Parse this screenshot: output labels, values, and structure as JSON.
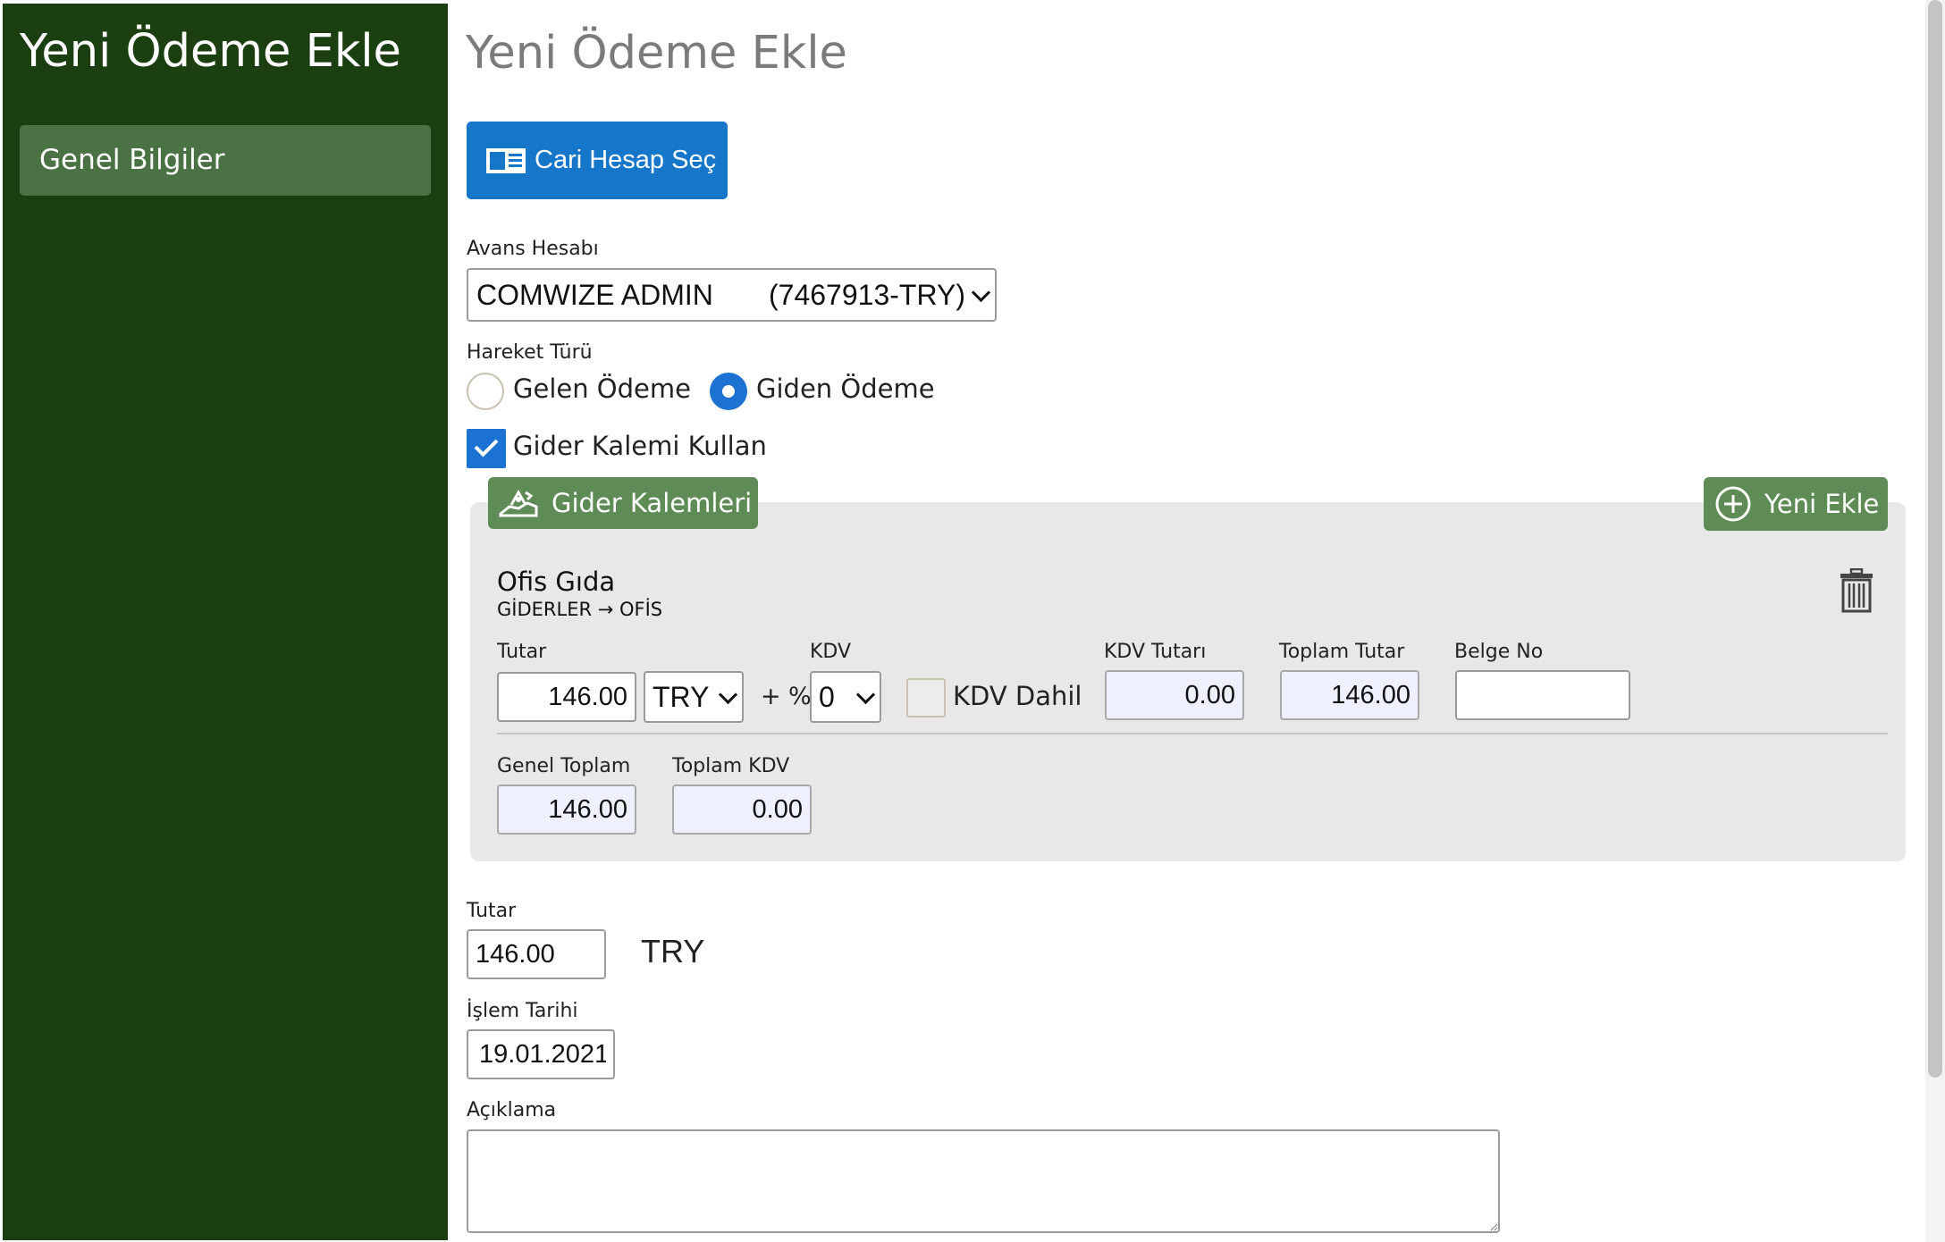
{
  "sidebar": {
    "title": "Yeni Ödeme Ekle",
    "items": [
      {
        "label": "Genel Bilgiler"
      }
    ]
  },
  "main": {
    "title": "Yeni Ödeme Ekle",
    "cari_button": "Cari Hesap Seç",
    "avans": {
      "label": "Avans Hesabı",
      "selected_name": "COMWIZE ADMIN",
      "selected_code": "(7467913-TRY)"
    },
    "hareket": {
      "label": "Hareket Türü",
      "options": [
        "Gelen Ödeme",
        "Giden Ödeme"
      ],
      "selected": "Giden Ödeme"
    },
    "gider_kalemi_kullan": {
      "label": "Gider Kalemi Kullan",
      "checked": true
    },
    "gider_panel": {
      "tab_label": "Gider Kalemleri",
      "add_label": "Yeni Ekle",
      "item": {
        "title": "Ofis Gıda",
        "path": "GİDERLER → OFİS",
        "tutar_label": "Tutar",
        "tutar_value": "146.00",
        "currency": "TRY",
        "plus": "+",
        "percent": "%",
        "kdv_label": "KDV",
        "kdv_value": "0",
        "kdv_dahil_label": "KDV Dahil",
        "kdv_tutari_label": "KDV Tutarı",
        "kdv_tutari_value": "0.00",
        "toplam_tutar_label": "Toplam Tutar",
        "toplam_tutar_value": "146.00",
        "belge_no_label": "Belge No",
        "belge_no_value": ""
      },
      "totals": {
        "genel_toplam_label": "Genel Toplam",
        "genel_toplam_value": "146.00",
        "toplam_kdv_label": "Toplam KDV",
        "toplam_kdv_value": "0.00"
      }
    },
    "tutar": {
      "label": "Tutar",
      "value": "146.00",
      "currency": "TRY"
    },
    "islem_tarihi": {
      "label": "İşlem Tarihi",
      "value": "19.01.2021"
    },
    "aciklama": {
      "label": "Açıklama",
      "value": ""
    }
  },
  "colors": {
    "sidebar_bg": "#1c3f12",
    "sidebar_item_bg": "#4b7244",
    "primary_button": "#1676c9",
    "green_button": "#5f8b56",
    "panel_bg": "#e8e8e8",
    "readonly_input_bg": "#eef0fe"
  },
  "icons": {
    "cari_button": "address-card-icon",
    "gider_tab": "hand-coins-icon",
    "yeni_ekle": "plus-circle-icon",
    "delete": "trash-icon"
  }
}
